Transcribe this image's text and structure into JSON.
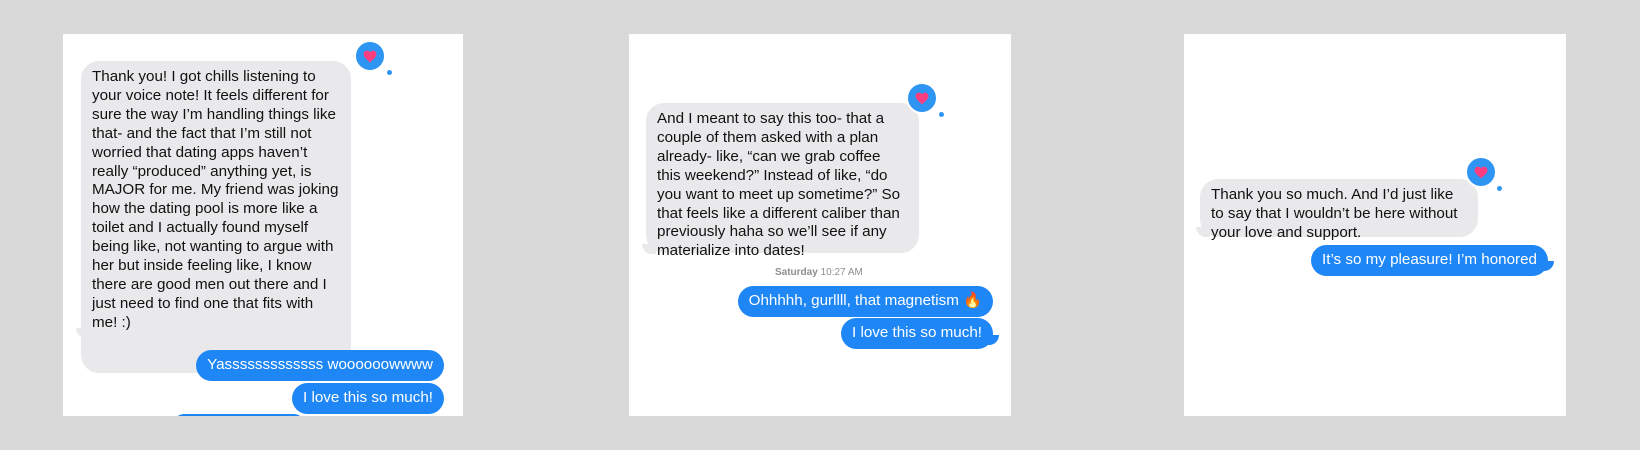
{
  "panels": [
    {
      "incoming": "Thank you! I got chills listening to your voice note! It feels different for sure the way I’m handling things like that- and the fact that I’m still not worried that dating apps haven’t really “produced” anything yet, is MAJOR for me. My friend was joking how the dating pool is more like a toilet and I actually found myself being like, not wanting to argue with her but inside feeling like, I know there are good men out there and I just need to find one that fits with me! :)",
      "reaction_icon": "heart-icon",
      "outgoing": [
        "Yasssssssssssss woooooowwww",
        "I love this so much!"
      ]
    },
    {
      "incoming": "And I meant to say this too- that a couple of them asked with a plan already- like, “can we grab coffee this weekend?” Instead of like, “do you want to meet up sometime?” So that feels like a different caliber than previously haha so we’ll see if any materialize into dates!",
      "reaction_icon": "heart-icon",
      "timestamp_day": "Saturday",
      "timestamp_time": "10:27 AM",
      "outgoing": [
        "Ohhhhh, gurllll, that magnetism 🔥",
        "I love this so much!"
      ]
    },
    {
      "incoming": "Thank you so much. And I’d just like to say that I wouldn’t be here without your love and support.",
      "reaction_icon": "heart-icon",
      "outgoing": [
        "It’s so my pleasure! I’m honored"
      ]
    }
  ],
  "colors": {
    "incoming_bubble": "#e9e9eb",
    "outgoing_bubble": "#1f86f5",
    "tapback_badge": "#2e95f2",
    "heart": "#ff3d7f",
    "background": "#d9d9d9"
  }
}
